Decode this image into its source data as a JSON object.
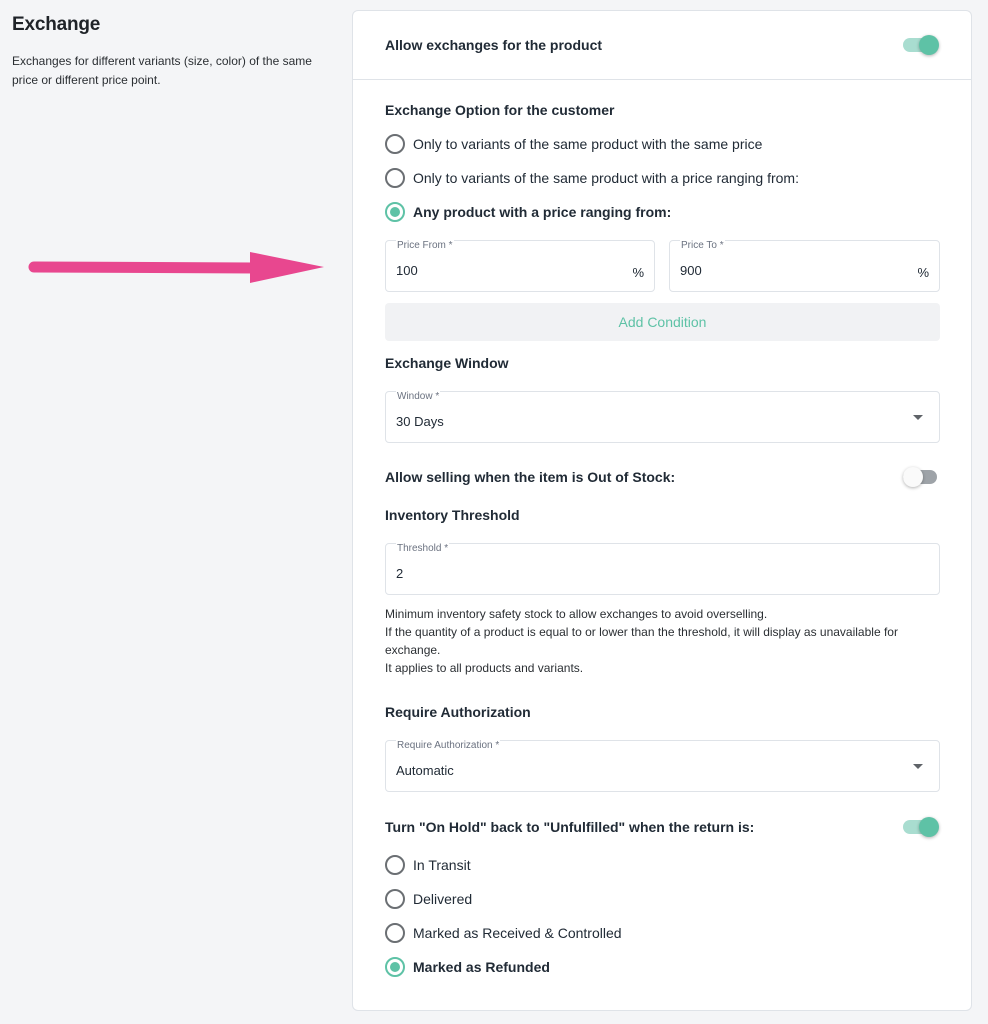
{
  "left": {
    "title": "Exchange",
    "description": "Exchanges for different variants (size, color) of the same price or different price point."
  },
  "colors": {
    "accent": "#5ec2a6",
    "arrow": "#e8478f"
  },
  "card": {
    "allow_exchanges_label": "Allow exchanges for the product",
    "allow_exchanges_enabled": true,
    "exchange_option_title": "Exchange Option for the customer",
    "exchange_options": [
      {
        "label": "Only to variants of the same product with the same price",
        "selected": false
      },
      {
        "label": "Only to variants of the same product with a price ranging from:",
        "selected": false
      },
      {
        "label": "Any product with a price ranging from:",
        "selected": true
      }
    ],
    "price_from": {
      "label": "Price From *",
      "value": "100",
      "suffix": "%"
    },
    "price_to": {
      "label": "Price To *",
      "value": "900",
      "suffix": "%"
    },
    "add_condition_label": "Add Condition",
    "exchange_window_title": "Exchange Window",
    "window_field": {
      "label": "Window *",
      "value": "30 Days"
    },
    "out_of_stock_label": "Allow selling when the item is Out of Stock:",
    "out_of_stock_enabled": false,
    "inventory_threshold_title": "Inventory Threshold",
    "threshold_field": {
      "label": "Threshold *",
      "value": "2"
    },
    "threshold_help": [
      "Minimum inventory safety stock to allow exchanges to avoid overselling.",
      "If the quantity of a product is equal to or lower than the threshold, it will display as unavailable for exchange.",
      "It applies to all products and variants."
    ],
    "require_auth_title": "Require Authorization",
    "require_auth_field": {
      "label": "Require Authorization *",
      "value": "Automatic"
    },
    "on_hold_label": "Turn \"On Hold\" back to \"Unfulfilled\" when the return is:",
    "on_hold_enabled": true,
    "return_states": [
      {
        "label": "In Transit",
        "selected": false
      },
      {
        "label": "Delivered",
        "selected": false
      },
      {
        "label": "Marked as Received & Controlled",
        "selected": false
      },
      {
        "label": "Marked as Refunded",
        "selected": true
      }
    ]
  }
}
